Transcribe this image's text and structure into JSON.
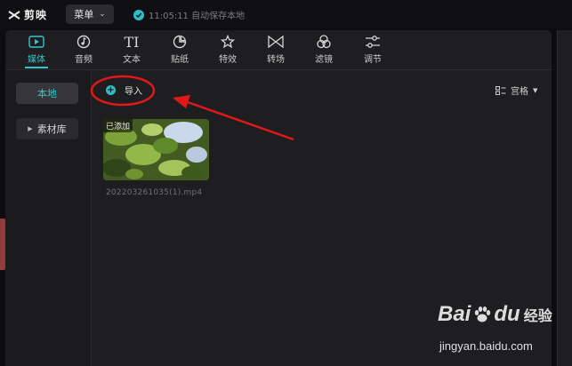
{
  "app": {
    "name": "剪映"
  },
  "header": {
    "menu_label": "菜单",
    "save_status": "11:05:11 自动保存本地"
  },
  "tabs": [
    {
      "label": "媒体",
      "icon": "media-icon",
      "active": true
    },
    {
      "label": "音频",
      "icon": "audio-icon"
    },
    {
      "label": "文本",
      "icon": "text-icon"
    },
    {
      "label": "贴纸",
      "icon": "sticker-icon"
    },
    {
      "label": "特效",
      "icon": "effects-icon"
    },
    {
      "label": "转场",
      "icon": "transition-icon"
    },
    {
      "label": "滤镜",
      "icon": "filter-icon"
    },
    {
      "label": "调节",
      "icon": "adjust-icon"
    }
  ],
  "sidebar": {
    "local_label": "本地",
    "library_label": "素材库"
  },
  "content": {
    "import_label": "导入",
    "view_label": "宫格",
    "media_items": [
      {
        "name": "202203261035(1).mp4",
        "tag": "已添加"
      }
    ]
  },
  "watermark": {
    "brand": "Bai",
    "brand_suffix": "du",
    "brand_cn": "经验",
    "url": "jingyan.baidu.com"
  },
  "colors": {
    "accent": "#34c6cf",
    "annotation": "#e01818",
    "background": "#0d0d0f",
    "panel": "#1e1e21"
  }
}
